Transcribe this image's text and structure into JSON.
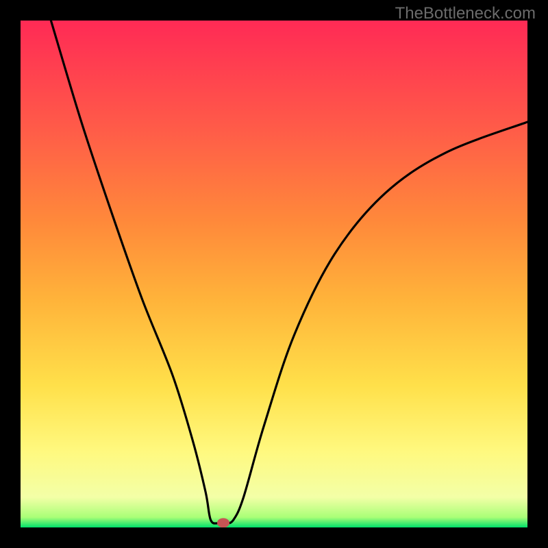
{
  "watermark": "TheBottleneck.com",
  "chart_data": {
    "type": "line",
    "title": "",
    "xlabel": "",
    "ylabel": "",
    "xlim": [
      0,
      100
    ],
    "ylim": [
      0,
      100
    ],
    "gradient_bands": [
      {
        "color": "#00e06b",
        "stop": 0.0
      },
      {
        "color": "#a9ff77",
        "stop": 2.0
      },
      {
        "color": "#f3ffa7",
        "stop": 6.0
      },
      {
        "color": "#fff97f",
        "stop": 15.0
      },
      {
        "color": "#ffe04a",
        "stop": 28.0
      },
      {
        "color": "#ffb33a",
        "stop": 45.0
      },
      {
        "color": "#ff8a3a",
        "stop": 60.0
      },
      {
        "color": "#ff5d48",
        "stop": 78.0
      },
      {
        "color": "#ff2a55",
        "stop": 100.0
      }
    ],
    "curve": [
      {
        "x": 6.0,
        "y": 100.0
      },
      {
        "x": 12.0,
        "y": 80.0
      },
      {
        "x": 18.0,
        "y": 62.0
      },
      {
        "x": 24.0,
        "y": 45.0
      },
      {
        "x": 30.0,
        "y": 30.0
      },
      {
        "x": 34.0,
        "y": 17.0
      },
      {
        "x": 36.5,
        "y": 7.0
      },
      {
        "x": 37.5,
        "y": 1.5
      },
      {
        "x": 39.0,
        "y": 0.8
      },
      {
        "x": 40.5,
        "y": 0.8
      },
      {
        "x": 42.0,
        "y": 1.5
      },
      {
        "x": 44.0,
        "y": 6.0
      },
      {
        "x": 48.0,
        "y": 20.0
      },
      {
        "x": 54.0,
        "y": 38.0
      },
      {
        "x": 62.0,
        "y": 54.0
      },
      {
        "x": 72.0,
        "y": 66.0
      },
      {
        "x": 84.0,
        "y": 74.0
      },
      {
        "x": 100.0,
        "y": 80.0
      }
    ],
    "marker": {
      "x": 40.0,
      "y": 0.9,
      "color": "#c75454"
    }
  }
}
